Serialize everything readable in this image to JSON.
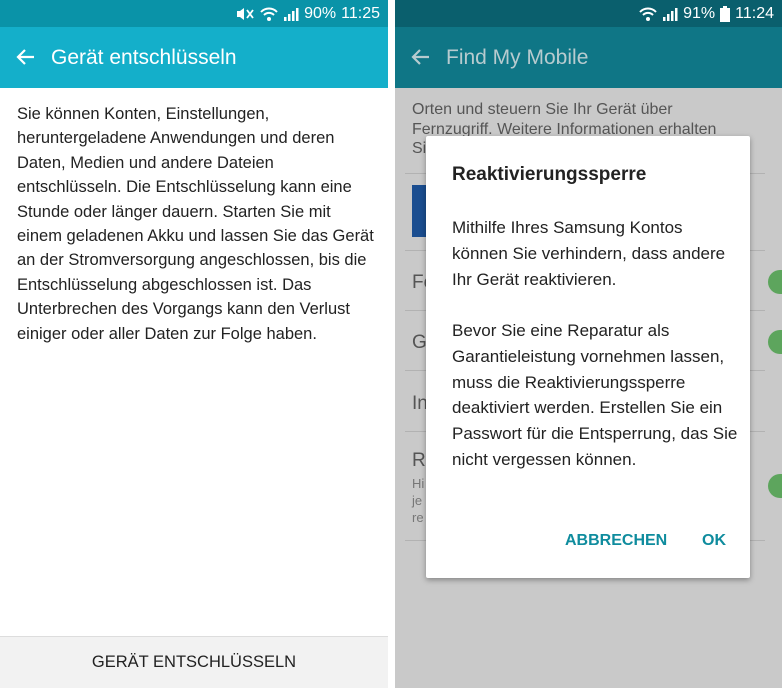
{
  "left": {
    "status": {
      "battery": "90%",
      "time": "11:25"
    },
    "title": "Gerät entschlüsseln",
    "body": "Sie können Konten, Einstellungen, heruntergeladene Anwendungen und deren Daten, Medien und andere Dateien entschlüsseln. Die Entschlüsselung kann eine Stunde oder länger dauern. Starten Sie mit einem geladenen Akku und lassen Sie das Gerät an der Stromversorgung angeschlossen, bis die Entschlüsselung abgeschlossen ist. Das Unterbrechen des Vorgangs kann den Verlust einiger oder aller Daten zur Folge haben.",
    "button": "GERÄT ENTSCHLÜSSELN"
  },
  "right": {
    "status": {
      "battery": "91%",
      "time": "11:24"
    },
    "title": "Find My Mobile",
    "background": {
      "intro_line1": "Orten und steuern Sie Ihr Gerät über",
      "intro_line2": "Fernzugriff. Weitere Informationen erhalten",
      "intro_line3": "Si",
      "row1": "Fe",
      "row2": "G",
      "row3": "In",
      "row4": "R",
      "row4_small1": "Hi",
      "row4_small2": "je",
      "row4_small3": "re"
    },
    "dialog": {
      "title": "Reaktivierungssperre",
      "paragraph1": "Mithilfe Ihres Samsung Kontos können Sie verhindern, dass andere Ihr Gerät reaktivieren.",
      "paragraph2": "Bevor Sie eine Reparatur als Garantieleistung vornehmen lassen, muss die Reaktivierungssperre deaktiviert werden. Erstellen Sie ein Passwort für die Entsperrung, das Sie nicht vergessen können.",
      "cancel": "ABBRECHEN",
      "ok": "OK"
    }
  },
  "colors": {
    "accent": "#14afca",
    "dialog_button": "#0f8c9e",
    "toggle": "#5da55d"
  },
  "icons": [
    "mute-icon",
    "wifi-icon",
    "signal-icon",
    "battery-icon",
    "back-arrow-icon"
  ]
}
